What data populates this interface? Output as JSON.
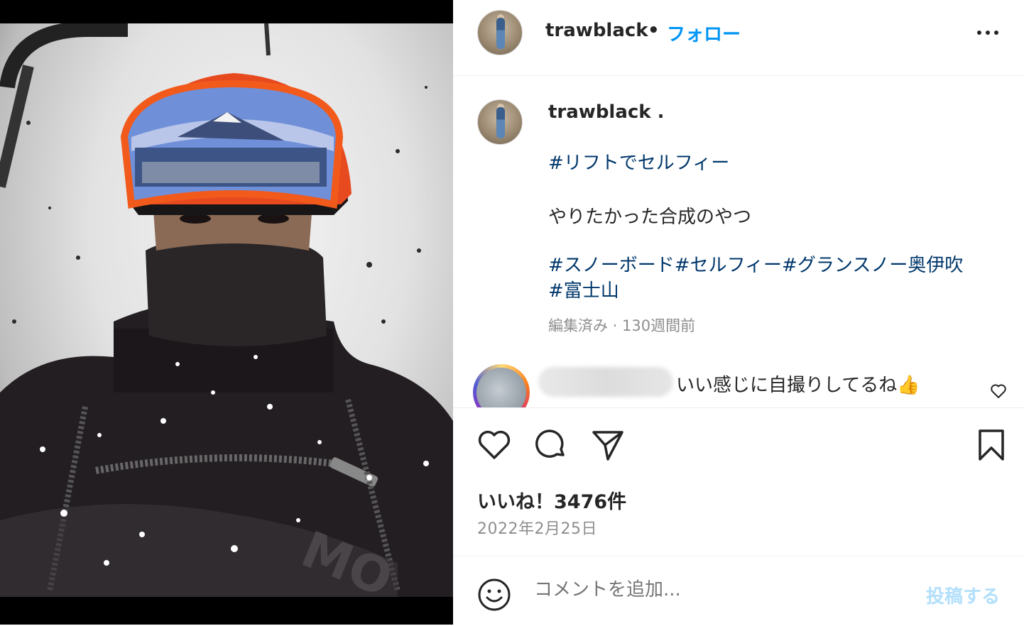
{
  "post": {
    "author": {
      "username": "trawblack"
    },
    "header": {
      "separator": "•",
      "follow_label": "フォロー"
    },
    "caption": {
      "username_line": "trawblack .",
      "line1": "#リフトでセルフィー",
      "line2": "やりたかった合成のやつ",
      "tags_line1": "#スノーボード#セルフィー#グランスノー奥伊吹",
      "tags_line2": "#富士山",
      "meta": "編集済み · 130週間前"
    },
    "comment": {
      "text": "いい感じに自撮りしてるね👍"
    },
    "likes_text": "いいね！3476件",
    "date_text": "2022年2月25日",
    "comment_box": {
      "placeholder": "コメントを追加...",
      "post_label": "投稿する"
    }
  },
  "colors": {
    "accent": "#0095f6",
    "hashtag": "#00376b",
    "muted": "#8e8e8e",
    "post_disabled": "#b2dffc"
  },
  "icons": [
    "more-options-icon",
    "heart-icon",
    "comment-icon",
    "share-icon",
    "bookmark-icon",
    "emoji-icon",
    "small-heart-icon"
  ]
}
